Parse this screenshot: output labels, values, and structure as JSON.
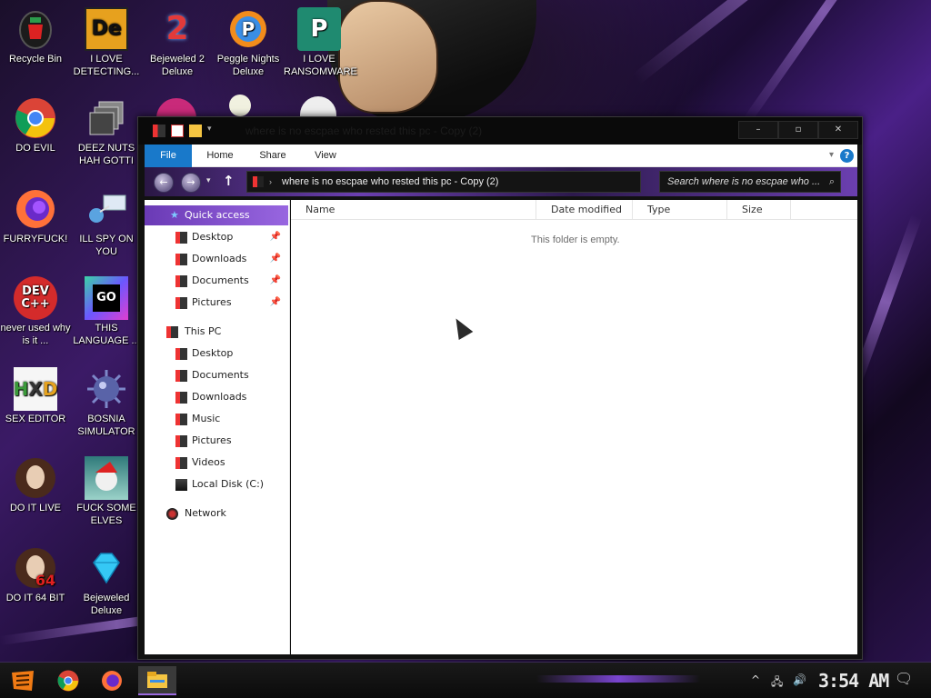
{
  "desktop": {
    "icons": [
      {
        "label": "Recycle Bin",
        "icon": "recycle-bin-icon"
      },
      {
        "label": "I LOVE DETECTING...",
        "icon": "die-icon"
      },
      {
        "label": "Bejeweled 2 Deluxe",
        "icon": "bejeweled2-icon"
      },
      {
        "label": "Peggle Nights Deluxe",
        "icon": "peggle-icon"
      },
      {
        "label": "I LOVE RANSOMWARE",
        "icon": "publisher-icon"
      },
      {
        "label": "DO EVIL",
        "icon": "chrome-icon"
      },
      {
        "label": "DEEZ NUTS HAH GOTTI",
        "icon": "copy-windows-icon"
      },
      {
        "label": "FURRYFUCK!",
        "icon": "firefox-icon"
      },
      {
        "label": "ILL SPY ON YOU",
        "icon": "network-spy-icon"
      },
      {
        "label": "never used why is it ...",
        "icon": "devcpp-icon"
      },
      {
        "label": "THIS LANGUAGE ...",
        "icon": "goland-icon"
      },
      {
        "label": "SEX EDITOR",
        "icon": "hxd-icon"
      },
      {
        "label": "BOSNIA SIMULATOR",
        "icon": "mine-icon"
      },
      {
        "label": "DO IT LIVE",
        "icon": "portrait-icon"
      },
      {
        "label": "FUCK SOME ELVES",
        "icon": "santa-icon"
      },
      {
        "label": "DO IT 64 BIT",
        "icon": "portrait-64-icon"
      },
      {
        "label": "Bejeweled Deluxe",
        "icon": "diamond-icon"
      }
    ]
  },
  "explorer": {
    "title": "where is no escpae who rested this pc - Copy (2)",
    "controls": {
      "minimize": "–",
      "maximize": "▫",
      "close": "✕"
    },
    "ribbon_tabs": [
      "File",
      "Home",
      "Share",
      "View"
    ],
    "help": "?",
    "address": "where is no escpae who rested this pc - Copy (2)",
    "search_placeholder": "Search where is no escpae who ...",
    "nav": {
      "quick_access": "Quick access",
      "quick_items": [
        "Desktop",
        "Downloads",
        "Documents",
        "Pictures"
      ],
      "this_pc": "This PC",
      "pc_items": [
        "Desktop",
        "Documents",
        "Downloads",
        "Music",
        "Pictures",
        "Videos",
        "Local Disk (C:)"
      ],
      "network": "Network"
    },
    "columns": [
      "Name",
      "Date modified",
      "Type",
      "Size"
    ],
    "empty_message": "This folder is empty."
  },
  "taskbar": {
    "clock": "3:54 AM",
    "pinned": [
      "start-icon",
      "chrome-icon",
      "firefox-icon",
      "file-explorer-icon"
    ]
  }
}
